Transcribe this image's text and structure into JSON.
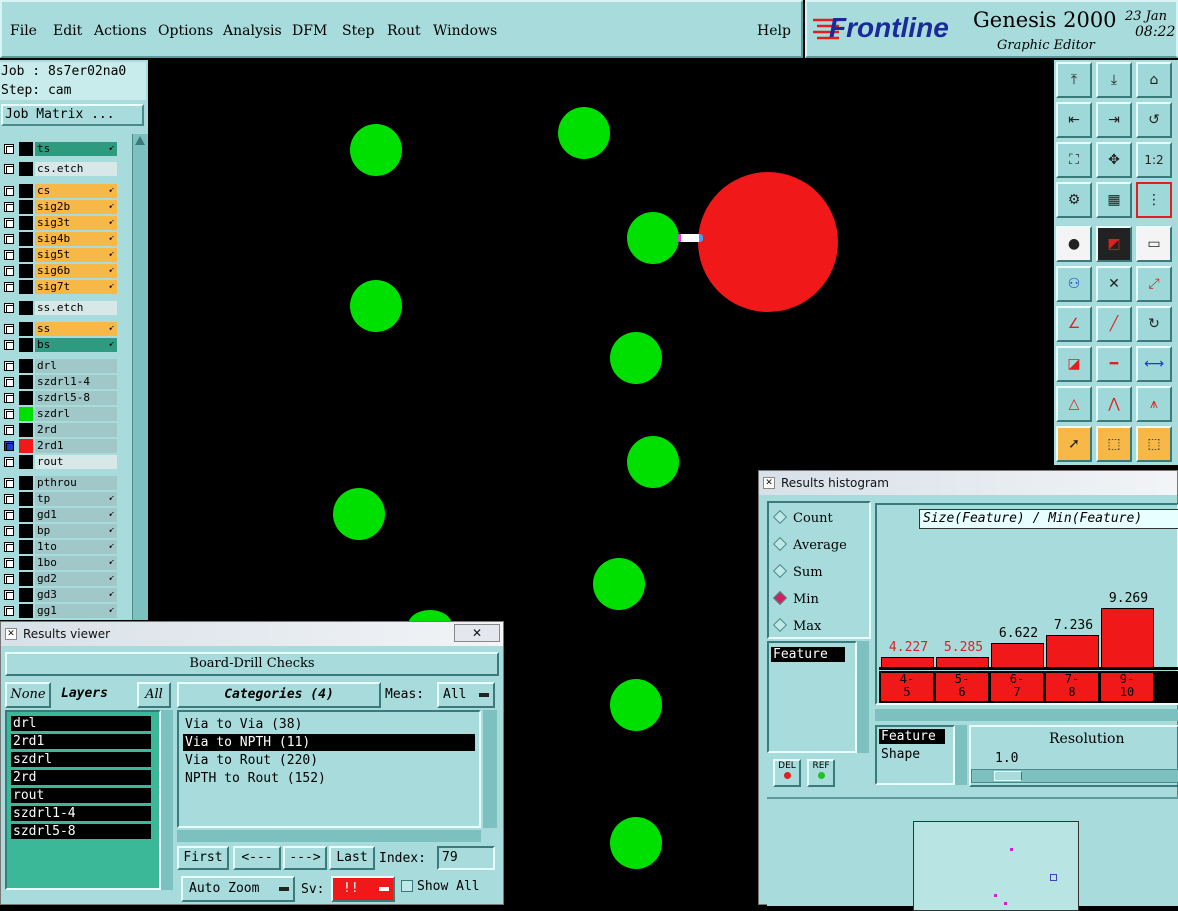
{
  "menu": {
    "items": [
      "File",
      "Edit",
      "Actions",
      "Options",
      "Analysis",
      "DFM",
      "Step",
      "Rout",
      "Windows"
    ],
    "help": "Help"
  },
  "brand": {
    "logo": "Frontline",
    "product": "Genesis 2000",
    "subtitle": "Graphic Editor",
    "date": "23 Jan",
    "time": "08:22"
  },
  "job": {
    "job_line": "Job : 8s7er02na0",
    "step_line": "Step: cam",
    "matrix_button": "Job Matrix ..."
  },
  "layers": [
    {
      "name": "ts",
      "color": "teal",
      "arrow": true
    },
    {
      "name": "cs.etch",
      "color": "light",
      "arrow": false
    },
    {
      "name": "cs",
      "color": "orange",
      "arrow": true
    },
    {
      "name": "sig2b",
      "color": "orange",
      "arrow": true
    },
    {
      "name": "sig3t",
      "color": "orange",
      "arrow": true
    },
    {
      "name": "sig4b",
      "color": "orange",
      "arrow": true
    },
    {
      "name": "sig5t",
      "color": "orange",
      "arrow": true
    },
    {
      "name": "sig6b",
      "color": "orange",
      "arrow": true
    },
    {
      "name": "sig7t",
      "color": "orange",
      "arrow": true
    },
    {
      "name": "ss.etch",
      "color": "light",
      "arrow": false
    },
    {
      "name": "ss",
      "color": "orange",
      "arrow": true
    },
    {
      "name": "bs",
      "color": "teal",
      "arrow": true
    },
    {
      "name": "drl",
      "color": "gray",
      "arrow": false
    },
    {
      "name": "szdrl1-4",
      "color": "gray",
      "arrow": false
    },
    {
      "name": "szdrl5-8",
      "color": "gray",
      "arrow": false
    },
    {
      "name": "szdrl",
      "color": "gray",
      "arrow": false
    },
    {
      "name": "2rd",
      "color": "gray",
      "arrow": false
    },
    {
      "name": "2rd1",
      "color": "gray",
      "arrow": false
    },
    {
      "name": "rout",
      "color": "light",
      "arrow": false
    },
    {
      "name": "pthrou",
      "color": "gray",
      "arrow": false
    },
    {
      "name": "tp",
      "color": "gray",
      "arrow": true
    },
    {
      "name": "gd1",
      "color": "gray",
      "arrow": true
    },
    {
      "name": "bp",
      "color": "gray",
      "arrow": true
    },
    {
      "name": "1to",
      "color": "gray",
      "arrow": true
    },
    {
      "name": "1bo",
      "color": "gray",
      "arrow": true
    },
    {
      "name": "gd2",
      "color": "gray",
      "arrow": true
    },
    {
      "name": "gd3",
      "color": "gray",
      "arrow": true
    },
    {
      "name": "gg1",
      "color": "gray",
      "arrow": true
    }
  ],
  "results_viewer": {
    "title": "Results viewer",
    "header": "Board-Drill Checks",
    "none_btn": "None",
    "layers_label": "Layers",
    "all_btn": "All",
    "categories_label": "Categories (4)",
    "meas_label": "Meas:",
    "meas_value": "All",
    "layer_list": [
      "drl",
      "2rd1",
      "szdrl",
      "2rd",
      "rout",
      "szdrl1-4",
      "szdrl5-8"
    ],
    "categories": [
      "Via to Via  (38)",
      "Via to NPTH  (11)",
      "Via to Rout  (220)",
      "NPTH to Rout  (152)"
    ],
    "selected_category": 1,
    "nav": {
      "first": "First",
      "prev": "<---",
      "next": "--->",
      "last": "Last",
      "index_label": "Index:",
      "index_value": "79"
    },
    "auto_zoom": "Auto Zoom",
    "sv_label": "Sv:",
    "sv_value": "!!",
    "show_all": "Show All"
  },
  "histogram": {
    "title": "Results histogram",
    "modes": [
      "Count",
      "Average",
      "Sum",
      "Min",
      "Max"
    ],
    "selected_mode": "Min",
    "chart_title": "Size(Feature) / Min(Feature)",
    "feature_list": [
      "Feature"
    ],
    "del_btn": "DEL",
    "ref_btn": "REF",
    "attr_list": [
      "Feature",
      "Shape"
    ],
    "resolution_label": "Resolution",
    "resolution_value": "1.0"
  },
  "chart_data": {
    "type": "bar",
    "title": "Size(Feature) / Min(Feature)",
    "categories": [
      "4-5",
      "5-6",
      "6-7",
      "7-8",
      "9-10"
    ],
    "category_lines": [
      [
        "4-",
        "5"
      ],
      [
        "5-",
        "6"
      ],
      [
        "6-",
        "7"
      ],
      [
        "7-",
        "8"
      ],
      [
        "9-",
        "10"
      ]
    ],
    "values": [
      4.227,
      5.285,
      6.622,
      7.236,
      9.269
    ],
    "value_labels": [
      "4.227",
      "5.285",
      "6.622",
      "7.236",
      "9.269"
    ],
    "ylim": [
      0,
      10
    ]
  },
  "colors": {
    "panel": "#a8dcdc",
    "pad": "#00e000",
    "highlight_pad": "#f01818",
    "bar": "#f01818"
  }
}
